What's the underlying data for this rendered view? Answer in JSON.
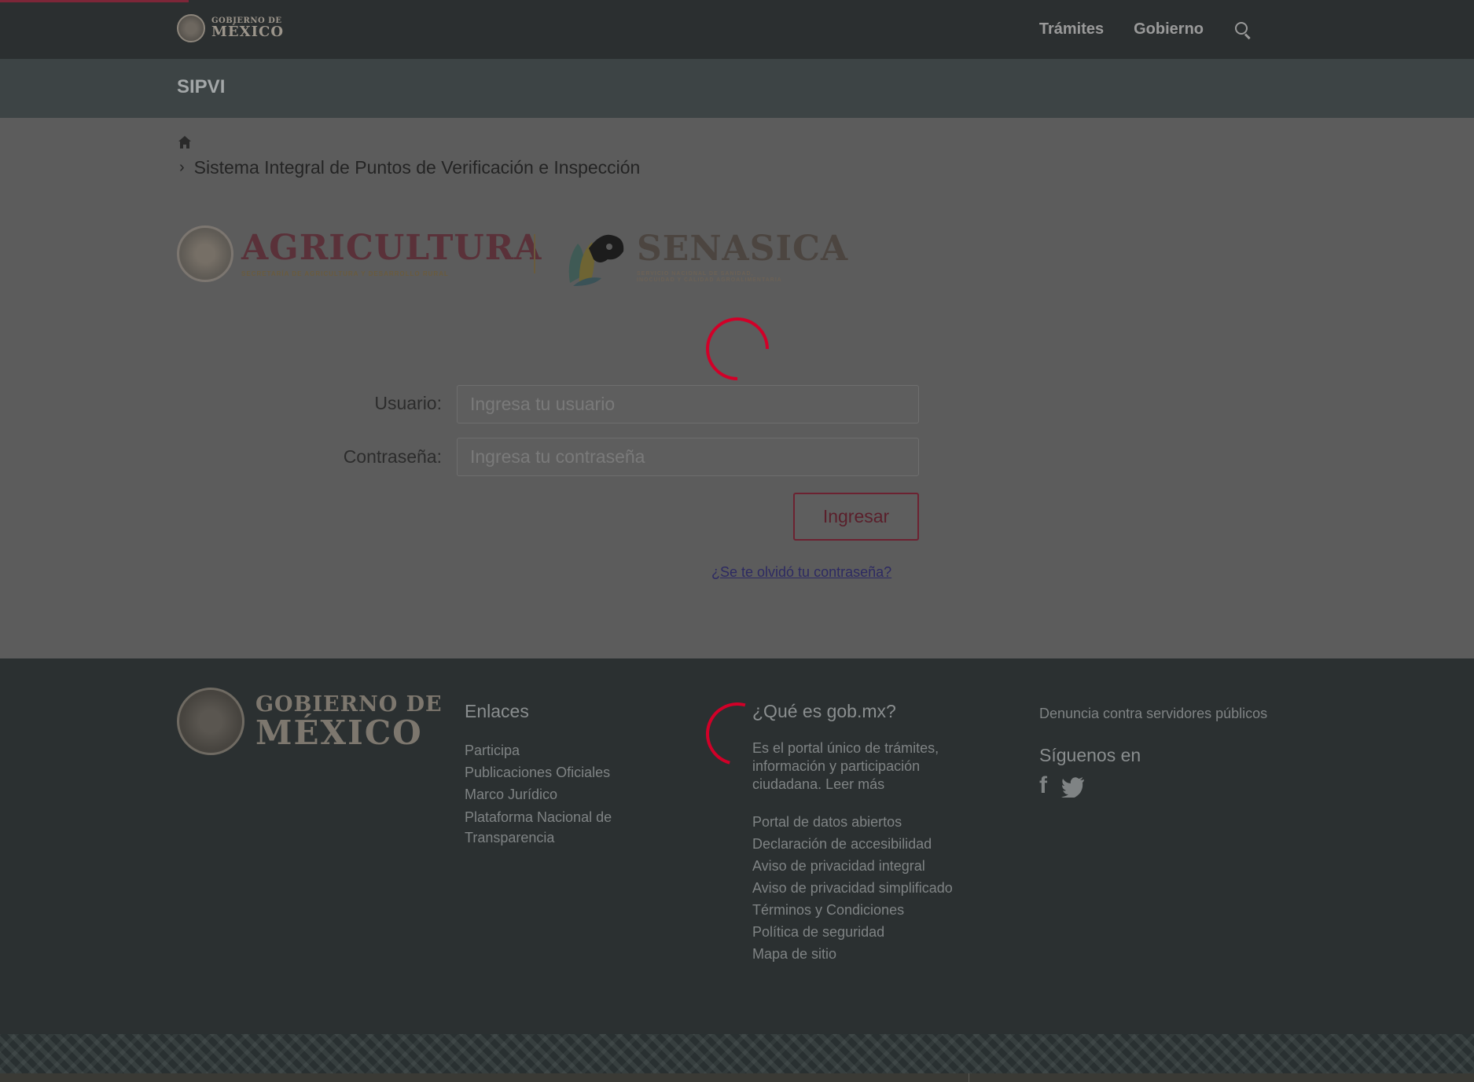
{
  "header": {
    "logo_line1": "GOBIERNO DE",
    "logo_line2": "MÉXICO",
    "nav": [
      "Trámites",
      "Gobierno"
    ],
    "search_icon": "search-icon"
  },
  "subheader": {
    "title": "SIPVI"
  },
  "breadcrumb": {
    "home_icon": "home-icon",
    "current": "Sistema Integral de Puntos de Verificación e Inspección"
  },
  "logos": {
    "agricultura_title": "AGRICULTURA",
    "agricultura_subtitle": "SECRETARÍA DE AGRICULTURA Y DESARROLLO RURAL",
    "senasica_title": "SENASICA",
    "senasica_subtitle_1": "SERVICIO NACIONAL DE SANIDAD,",
    "senasica_subtitle_2": "INOCUIDAD Y CALIDAD AGROALIMENTARIA"
  },
  "form": {
    "user_label": "Usuario:",
    "user_placeholder": "Ingresa tu usuario",
    "user_value": "",
    "password_label": "Contraseña:",
    "password_placeholder": "Ingresa tu contraseña",
    "password_value": "",
    "submit_label": "Ingresar",
    "forgot_link": "¿Se te olvidó tu contraseña?"
  },
  "footer": {
    "logo_line1": "GOBIERNO DE",
    "logo_line2": "MÉXICO",
    "enlaces_title": "Enlaces",
    "enlaces": [
      "Participa",
      "Publicaciones Oficiales",
      "Marco Jurídico",
      "Plataforma Nacional de Transparencia"
    ],
    "que_es_title": "¿Qué es gob.mx?",
    "que_es_text": "Es el portal único de trámites, información y participación ciudadana. Leer más",
    "links": [
      "Portal de datos abiertos",
      "Declaración de accesibilidad",
      "Aviso de privacidad integral",
      "Aviso de privacidad simplificado",
      "Términos y Condiciones",
      "Política de seguridad",
      "Mapa de sitio"
    ],
    "denuncia": "Denuncia contra servidores públicos",
    "siguenos_title": "Síguenos en",
    "social_icons": [
      "facebook-icon",
      "twitter-icon"
    ]
  },
  "colors": {
    "topbar": "#2b2f30",
    "subbar": "#3d4445",
    "overlay_bg": "#5c5c5c",
    "spinner": "#d10028",
    "brand": "#6c2231",
    "footer": "#2b3031"
  }
}
